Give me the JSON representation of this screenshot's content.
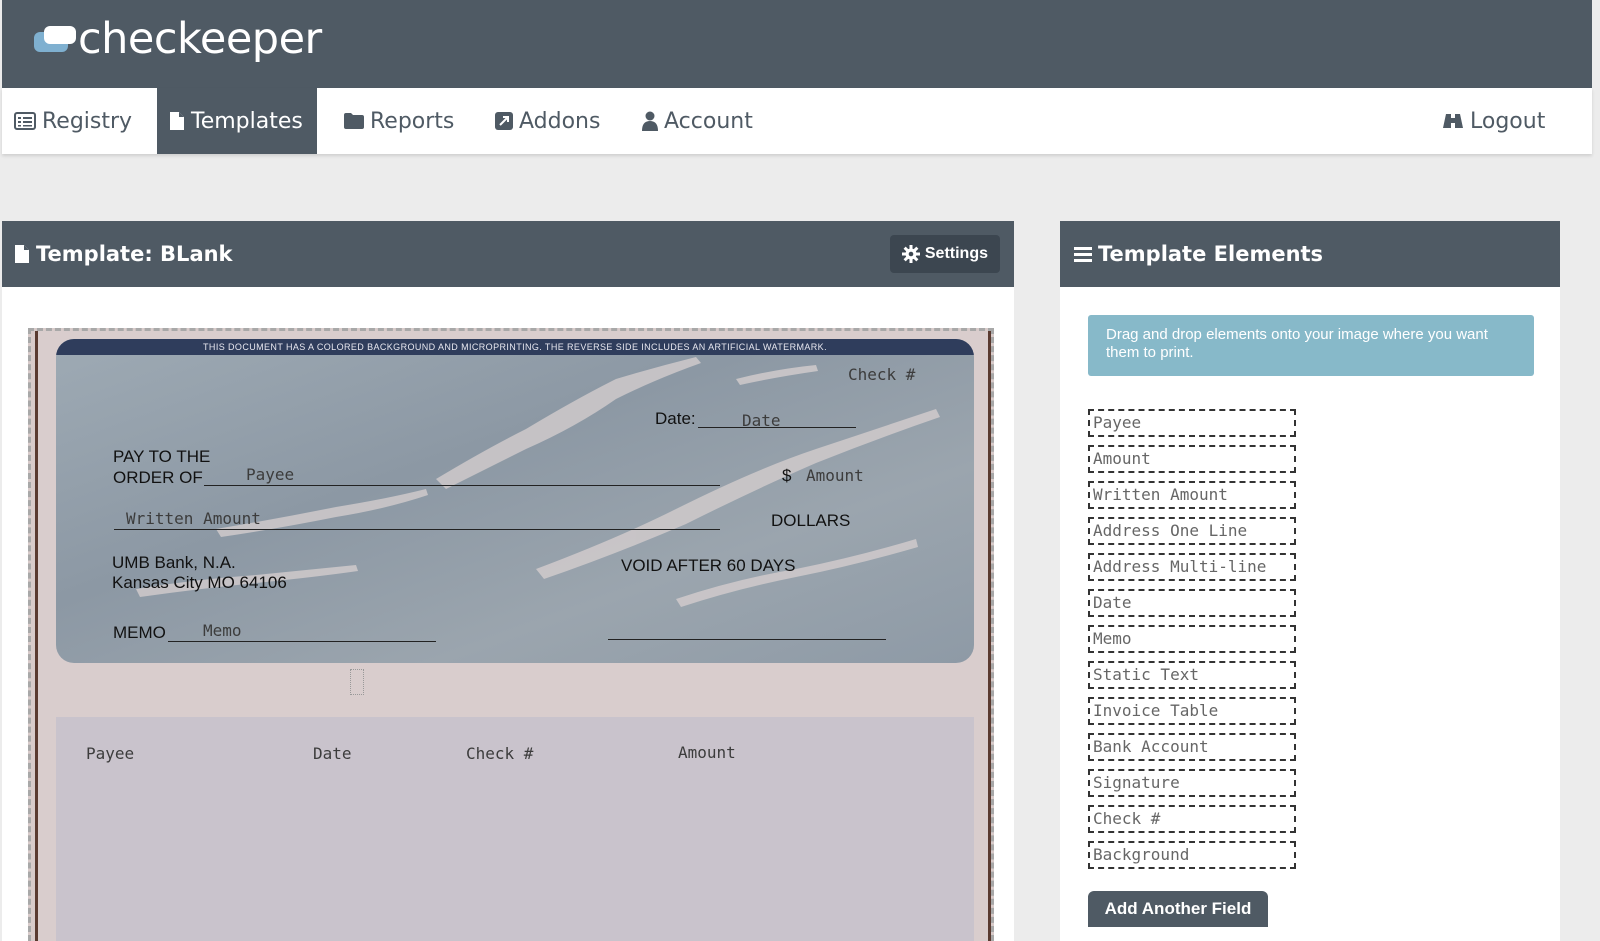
{
  "app": {
    "logo_text": "checkeeper"
  },
  "nav": {
    "items": [
      {
        "label": "Registry",
        "icon": "list-icon"
      },
      {
        "label": "Templates",
        "icon": "file-icon",
        "active": true
      },
      {
        "label": "Reports",
        "icon": "folder-icon"
      },
      {
        "label": "Addons",
        "icon": "external-link-icon"
      },
      {
        "label": "Account",
        "icon": "user-icon"
      }
    ],
    "logout_label": "Logout"
  },
  "template_panel": {
    "title": "Template: BLank",
    "settings_label": "Settings"
  },
  "check": {
    "banner": "THIS DOCUMENT HAS A COLORED BACKGROUND AND MICROPRINTING.  THE REVERSE SIDE INCLUDES AN ARTIFICIAL WATERMARK.",
    "check_num_field": "Check #",
    "date_label": "Date:",
    "date_field": "Date",
    "pay_to_line1": "PAY TO THE",
    "pay_to_line2": "ORDER OF",
    "payee_field": "Payee",
    "dollar_sign": "$",
    "amount_field": "Amount",
    "written_amount_field": "Written Amount",
    "dollars_label": "DOLLARS",
    "bank_line1": "UMB Bank, N.A.",
    "bank_line2": "Kansas City MO 64106",
    "void_label": "VOID AFTER 60 DAYS",
    "memo_label": "MEMO",
    "memo_field": "Memo",
    "stub_payee": "Payee",
    "stub_date": "Date",
    "stub_check": "Check #",
    "stub_amount": "Amount"
  },
  "elements_panel": {
    "title": "Template Elements",
    "info": "Drag and drop elements onto your image where you want them to print.",
    "items": [
      "Payee",
      "Amount",
      "Written Amount",
      "Address One Line",
      "Address Multi-line",
      "Date",
      "Memo",
      "Static Text",
      "Invoice Table",
      "Bank Account",
      "Signature",
      "Check #",
      "Background"
    ],
    "add_button": "Add Another Field"
  }
}
